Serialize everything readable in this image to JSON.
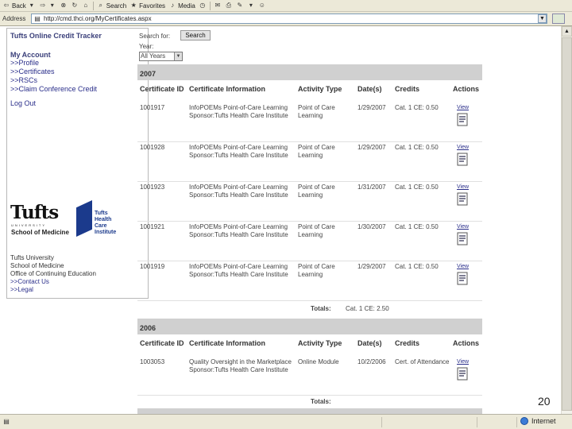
{
  "browser": {
    "toolbar": {
      "back_label": "Back",
      "search_label": "Search",
      "favorites_label": "Favorites",
      "media_label": "Media"
    },
    "address": {
      "label": "Address",
      "url": "http://cmd.thci.org/MyCertificates.aspx"
    },
    "status": {
      "zone": "Internet"
    }
  },
  "sidebar": {
    "title": "Tufts Online Credit Tracker",
    "account_heading": "My Account",
    "links": [
      ">>Profile",
      ">>Certificates",
      ">>RSCs",
      ">>Claim Conference Credit"
    ],
    "logout": "Log Out",
    "logo": {
      "tufts": "Tufts",
      "university": "UNIVERSITY",
      "school": "School of Medicine",
      "thci_line1": "Tufts",
      "thci_line2": "Health",
      "thci_line3": "Care",
      "thci_line4": "Institute"
    },
    "footer_lines": [
      "Tufts University",
      "School of Medicine",
      "Office of Continuing Education"
    ],
    "footer_links": [
      ">>Contact Us",
      ">>Legal"
    ]
  },
  "search": {
    "label": "Search for:",
    "button": "Search",
    "year_label": "Year:",
    "year_value": "All Years"
  },
  "columns": {
    "id": "Certificate ID",
    "info": "Certificate Information",
    "type": "Activity Type",
    "date": "Date(s)",
    "credits": "Credits",
    "actions": "Actions"
  },
  "groups": [
    {
      "year": "2007",
      "rows": [
        {
          "id": "1001917",
          "info": "InfoPOEMs Point-of-Care Learning Sponsor:Tufts Health Care Institute",
          "type": "Point of Care Learning",
          "date": "1/29/2007",
          "credits": "Cat. 1 CE: 0.50",
          "action": "View"
        },
        {
          "id": "1001928",
          "info": "InfoPOEMs Point-of-Care Learning Sponsor:Tufts Health Care Institute",
          "type": "Point of Care Learning",
          "date": "1/29/2007",
          "credits": "Cat. 1 CE: 0.50",
          "action": "View"
        },
        {
          "id": "1001923",
          "info": "InfoPOEMs Point-of-Care Learning Sponsor:Tufts Health Care Institute",
          "type": "Point of Care Learning",
          "date": "1/31/2007",
          "credits": "Cat. 1 CE: 0.50",
          "action": "View"
        },
        {
          "id": "1001921",
          "info": "InfoPOEMs Point-of-Care Learning Sponsor:Tufts Health Care Institute",
          "type": "Point of Care Learning",
          "date": "1/30/2007",
          "credits": "Cat. 1 CE: 0.50",
          "action": "View"
        },
        {
          "id": "1001919",
          "info": "InfoPOEMs Point-of-Care Learning Sponsor:Tufts Health Care Institute",
          "type": "Point of Care Learning",
          "date": "1/29/2007",
          "credits": "Cat. 1 CE: 0.50",
          "action": "View"
        }
      ],
      "totals_label": "Totals:",
      "totals_value": "Cat. 1 CE: 2.50"
    },
    {
      "year": "2006",
      "rows": [
        {
          "id": "1003053",
          "info": "Quality Oversight in the Marketplace Sponsor:Tufts Health Care Institute",
          "type": "Online Module",
          "date": "10/2/2006",
          "credits": "Cert. of Attendance",
          "action": "View"
        }
      ],
      "totals_label": "Totals:",
      "totals_value": ""
    }
  ],
  "page_number": "20"
}
